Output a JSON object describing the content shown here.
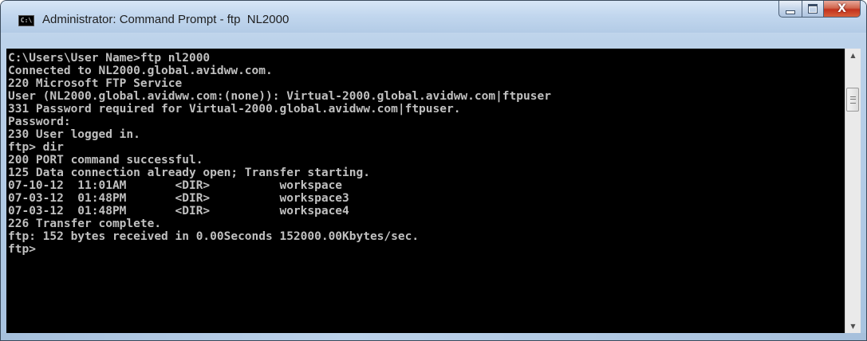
{
  "window": {
    "title": "Administrator: Command Prompt - ftp  NL2000",
    "icon": "cmd-icon",
    "icon_text": "C:\\",
    "buttons": {
      "minimize_icon": "minimize-icon",
      "maximize_icon": "maximize-icon",
      "close_label": "X"
    }
  },
  "console": {
    "background": "#000000",
    "foreground": "#c0c0c0",
    "lines": [
      "C:\\Users\\User Name>ftp nl2000",
      "Connected to NL2000.global.avidww.com.",
      "220 Microsoft FTP Service",
      "User (NL2000.global.avidww.com:(none)): Virtual-2000.global.avidww.com|ftpuser",
      "331 Password required for Virtual-2000.global.avidww.com|ftpuser.",
      "Password:",
      "230 User logged in.",
      "ftp> dir",
      "200 PORT command successful.",
      "125 Data connection already open; Transfer starting.",
      "07-10-12  11:01AM       <DIR>          workspace",
      "07-03-12  01:48PM       <DIR>          workspace3",
      "07-03-12  01:48PM       <DIR>          workspace4",
      "226 Transfer complete.",
      "ftp: 152 bytes received in 0.00Seconds 152000.00Kbytes/sec.",
      "ftp>"
    ]
  },
  "scrollbar": {
    "up_icon": "scroll-up-arrow-icon",
    "down_icon": "scroll-down-arrow-icon",
    "up_glyph": "▲",
    "down_glyph": "▼"
  }
}
